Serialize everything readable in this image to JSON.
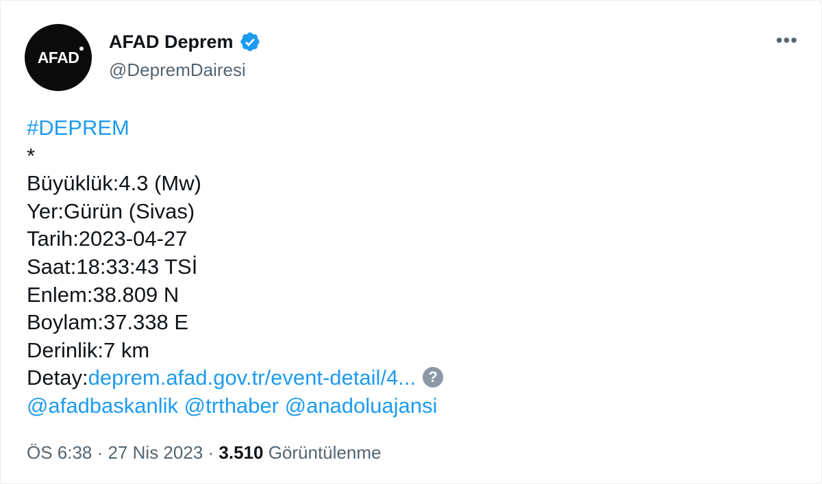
{
  "author": {
    "avatar_text": "AFAD",
    "display_name": "AFAD Deprem",
    "handle": "@DepremDairesi",
    "verified": true
  },
  "menu": {
    "more_label": "•••"
  },
  "tweet": {
    "hashtag": "#DEPREM",
    "separator": "*",
    "lines": [
      "Büyüklük:4.3 (Mw)",
      "Yer:Gürün (Sivas)",
      "Tarih:2023-04-27",
      "Saat:18:33:43 TSİ",
      "Enlem:38.809 N",
      "Boylam:37.338 E",
      "Derinlik:7 km"
    ],
    "detail_label": "Detay:",
    "detail_link": "deprem.afad.gov.tr/event-detail/4...",
    "detail_icon": "?",
    "mentions": [
      "@afadbaskanlik",
      "@trthaber",
      "@anadoluajansi"
    ]
  },
  "meta": {
    "time": "ÖS 6:38",
    "sep1": " · ",
    "date": "27 Nis 2023",
    "sep2": " · ",
    "view_count": "3.510",
    "view_label": " Görüntülenme"
  },
  "colors": {
    "link": "#1d9bf0",
    "verified": "#1d9bf0",
    "secondary_text": "#536471",
    "primary_text": "#0f1419",
    "avatar_bg": "#0b0b0b"
  }
}
